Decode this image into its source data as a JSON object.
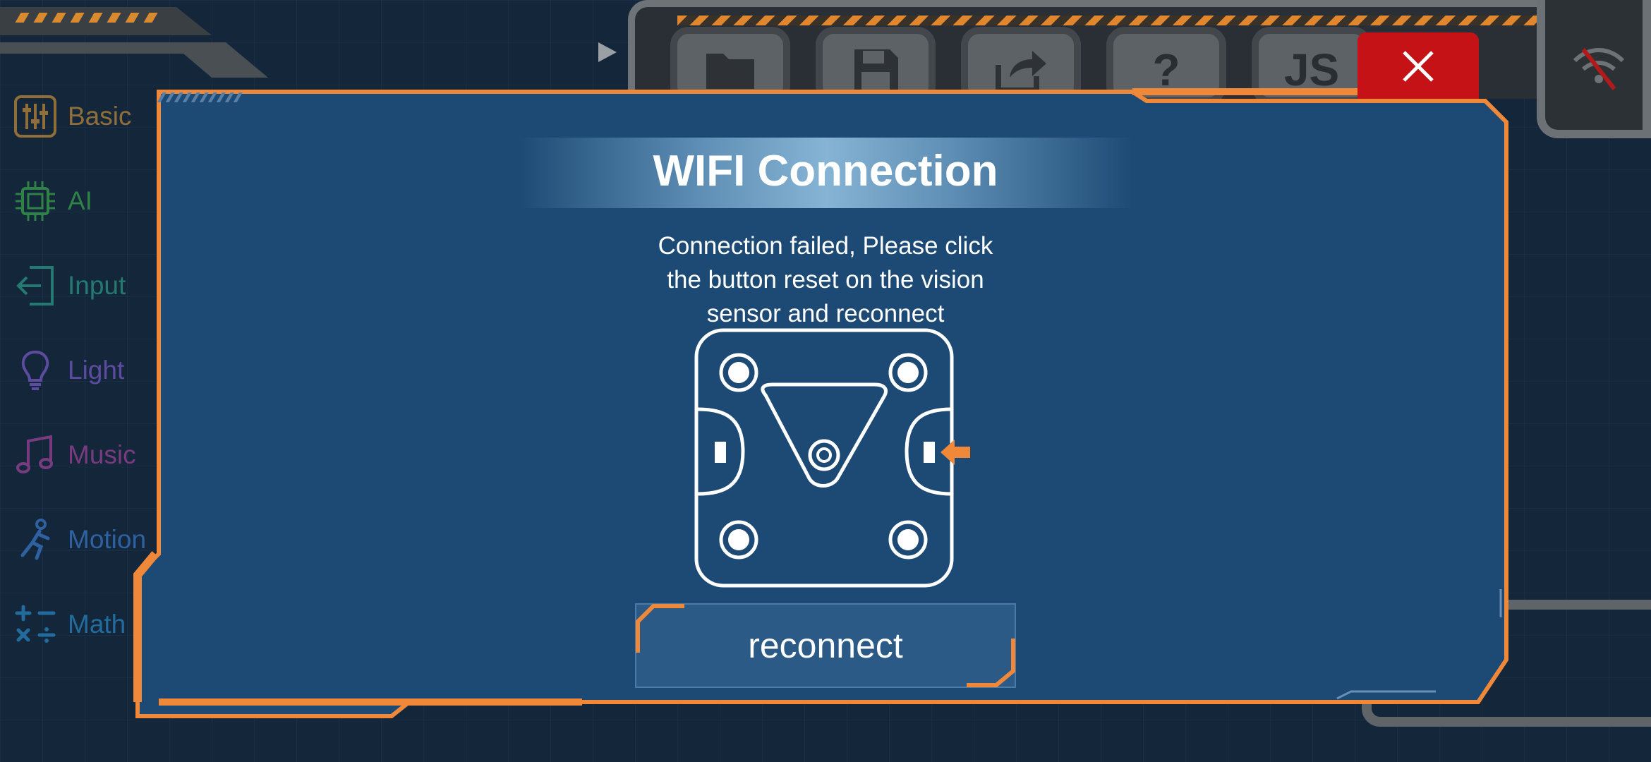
{
  "sidebar": {
    "items": [
      {
        "label": "Basic",
        "icon": "sliders-icon",
        "color": "#c08a3a"
      },
      {
        "label": "AI",
        "icon": "chip-icon",
        "color": "#3aa64a"
      },
      {
        "label": "Input",
        "icon": "input-arrow-icon",
        "color": "#2b9a8a"
      },
      {
        "label": "Light",
        "icon": "lightbulb-icon",
        "color": "#7a5ac8"
      },
      {
        "label": "Music",
        "icon": "music-note-icon",
        "color": "#a0449a"
      },
      {
        "label": "Motion",
        "icon": "motion-figure-icon",
        "color": "#3a78c8"
      },
      {
        "label": "Math",
        "icon": "math-operators-icon",
        "color": "#2a86c4"
      }
    ]
  },
  "toolbar": {
    "buttons": [
      {
        "name": "folder",
        "icon": "folder-icon"
      },
      {
        "name": "save",
        "icon": "save-icon"
      },
      {
        "name": "share",
        "icon": "share-icon"
      },
      {
        "name": "help",
        "icon": "question-icon",
        "glyph": "?"
      },
      {
        "name": "js",
        "icon": "js-icon",
        "glyph": "JS"
      }
    ],
    "wifi_status_icon": "wifi-off-icon"
  },
  "modal": {
    "title": "WIFI Connection",
    "message_lines": [
      "Connection failed, Please click",
      "the button reset on the vision",
      "sensor and reconnect"
    ],
    "illustration_icon": "vision-sensor-reset-diagram-icon",
    "reconnect_label": "reconnect",
    "close_icon": "close-icon"
  },
  "colors": {
    "accent": "#f0883a",
    "modal_bg": "#1c4a74",
    "close_red": "#c41217",
    "button_bg": "#2a5a85"
  }
}
